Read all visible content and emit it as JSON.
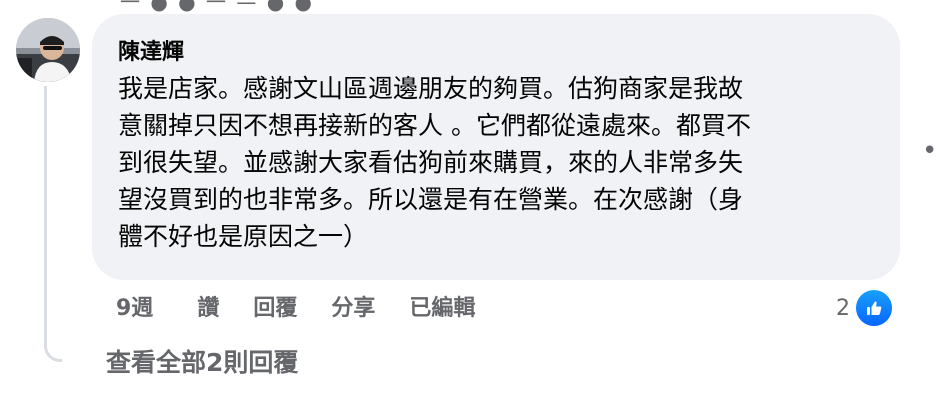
{
  "top_partial_text": "一 ● ● 一 — ● ●",
  "comment": {
    "author": "陳達輝",
    "lines": [
      "我是店家。感謝文山區週邊朋友的夠買。估狗商家是我故",
      "意關掉只因不想再接新的客人 。它們都從遠處來。都買不",
      "到很失望。並感謝大家看估狗前來購買，來的人非常多失",
      "望沒買到的也非常多。所以還是有在營業。在次感謝（身",
      "體不好也是原因之一）"
    ]
  },
  "actions": {
    "time": "9週",
    "like": "讚",
    "reply": "回覆",
    "share": "分享",
    "edited": "已編輯"
  },
  "reactions": {
    "count": "2",
    "icon": "thumbs-up-icon",
    "color": "#0866ff"
  },
  "view_replies": "查看全部2則回覆",
  "more_options_icon": "more-dots-icon",
  "colors": {
    "bubble": "#f0f2f5",
    "secondary_text": "#65676b",
    "thread_line": "#dadde1"
  }
}
